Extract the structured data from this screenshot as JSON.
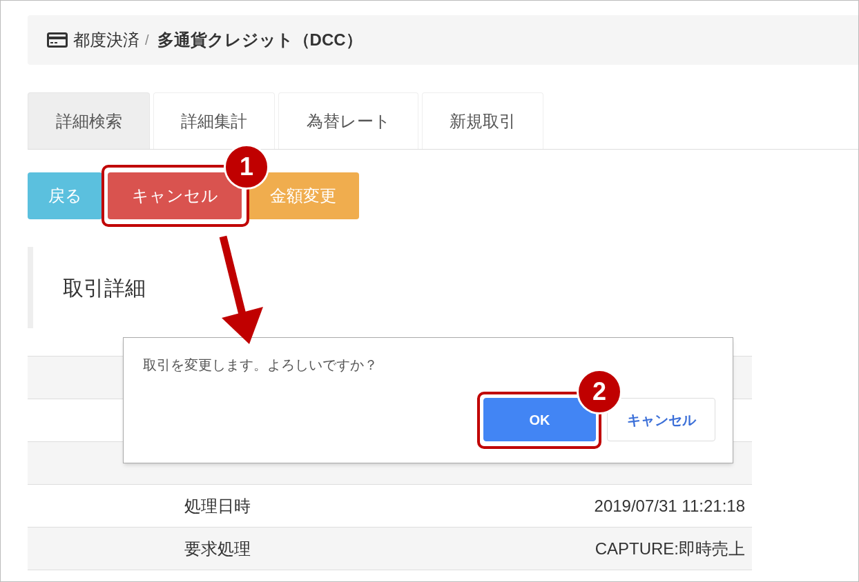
{
  "breadcrumb": [
    {
      "label": "都度決済",
      "kind": "link"
    },
    {
      "label": "/",
      "kind": "separator"
    },
    {
      "label": "多通貨クレジット（DCC）",
      "kind": "current"
    }
  ],
  "tabs": [
    {
      "label": "詳細検索",
      "selected": true
    },
    {
      "label": "詳細集計",
      "selected": false
    },
    {
      "label": "為替レート",
      "selected": false
    },
    {
      "label": "新規取引",
      "selected": false
    }
  ],
  "buttons": [
    {
      "label": "戻る",
      "kind": "info"
    },
    {
      "label": "キャンセル",
      "kind": "danger"
    },
    {
      "label": "金額変更",
      "kind": "warning"
    }
  ],
  "section_title": "取引詳細",
  "table": {
    "rows": [
      {},
      {},
      {},
      {
        "label": "処理日時",
        "value": "2019/07/31 11:21:18"
      },
      {
        "label": "要求処理",
        "value": "CAPTURE:即時売上"
      }
    ]
  },
  "dialog": {
    "message": "取引を変更します。よろしいですか？",
    "buttons": [
      {
        "label": "OK",
        "kind": "primary"
      },
      {
        "label": "キャンセル",
        "kind": "secondary"
      }
    ]
  },
  "annotations": [
    {
      "number": "1"
    },
    {
      "number": "2"
    }
  ]
}
